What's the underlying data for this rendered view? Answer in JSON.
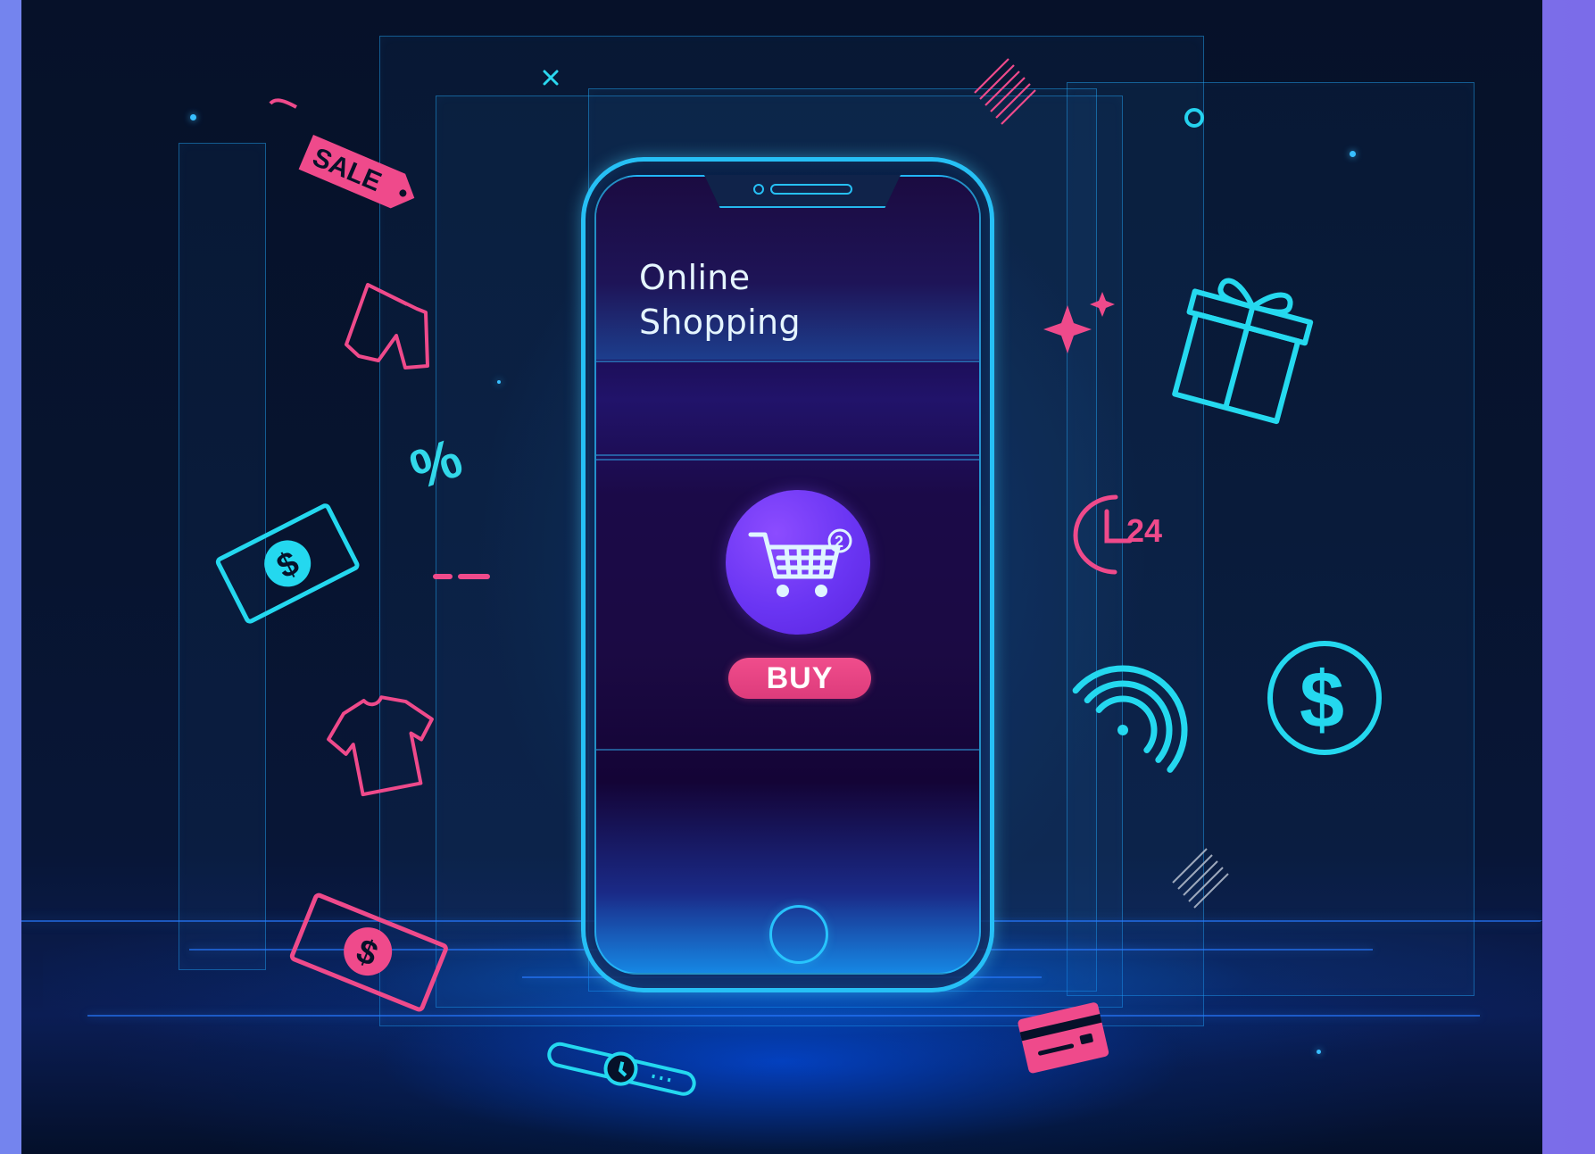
{
  "screen": {
    "title": "Online\nShopping",
    "cart_badge": "2",
    "buy_label": "BUY"
  },
  "icons": {
    "sale_tag_text": "SALE",
    "percent": "%",
    "timer_badge": "24",
    "dollar_sign": "$"
  },
  "colors": {
    "background_outer": "#7680ec",
    "scene_top": "#061129",
    "scene_bottom": "#0b1d54",
    "cyan": "#29d3ff",
    "pink": "#f04d8c",
    "purple": "#6a35f3"
  }
}
